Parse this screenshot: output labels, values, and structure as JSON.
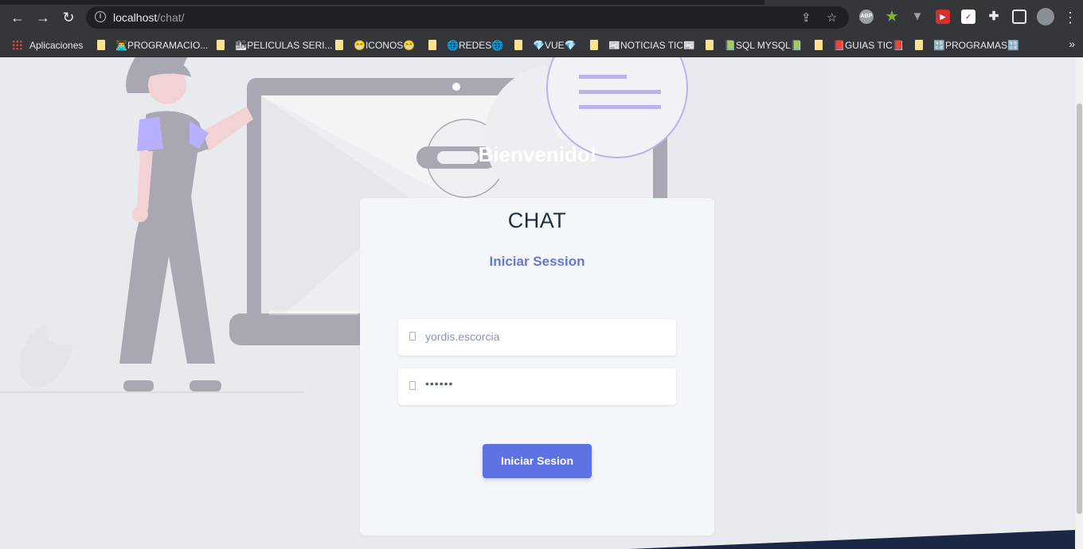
{
  "browser": {
    "url_host": "localhost",
    "url_path": "/chat/",
    "bookmarks": [
      {
        "label": "Aplicaciones"
      },
      {
        "label": "👨‍💻PROGRAMACIO..."
      },
      {
        "label": "🏙PELICULAS SERI..."
      },
      {
        "label": "😁ICONOS😁"
      },
      {
        "label": "🌐REDES🌐"
      },
      {
        "label": "💎VUE💎"
      },
      {
        "label": "📰NOTICIAS TIC📰"
      },
      {
        "label": "📗SQL MYSQL📗"
      },
      {
        "label": "📕GUIAS TIC📕"
      },
      {
        "label": "🔡PROGRAMAS🔡"
      }
    ],
    "ext_abp": "ABP"
  },
  "page": {
    "welcome": "Bienvenido!",
    "card_title": "CHAT",
    "card_subtitle": "Iniciar Session",
    "username_value": "yordis.escorcia",
    "password_value": "••••••",
    "submit_label": "Iniciar Sesion"
  },
  "colors": {
    "accent": "#5e72e4",
    "subtitle": "#6676d8",
    "background": "#e9eaee"
  }
}
